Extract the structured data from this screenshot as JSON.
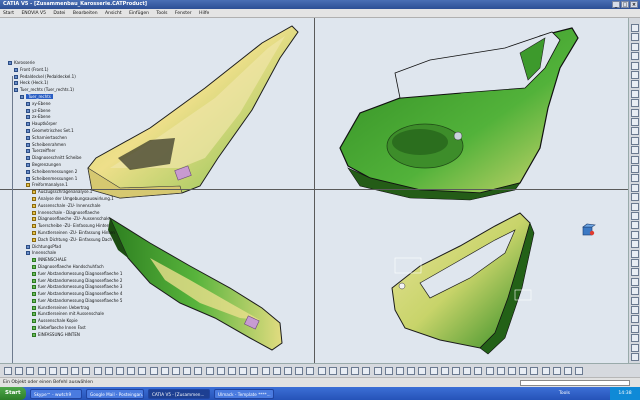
{
  "window": {
    "title": "CATIA V5 - [Zusammenbau_Karosserie.CATProduct]",
    "controls": [
      "_",
      "□",
      "×"
    ]
  },
  "menu": [
    "Start",
    "ENOVIA V5",
    "Datei",
    "Bearbeiten",
    "Ansicht",
    "Einfügen",
    "Tools",
    "Fenster",
    "Hilfe"
  ],
  "tree": [
    {
      "label": "Karosserie",
      "indent": 0,
      "icon": "product-icon"
    },
    {
      "label": "Front (Front.1)",
      "indent": 1,
      "icon": "part-icon"
    },
    {
      "label": "Pedaldeckel (Pedaldeckel.1)",
      "indent": 1,
      "icon": "part-icon"
    },
    {
      "label": "Heck (Heck.1)",
      "indent": 1,
      "icon": "part-icon"
    },
    {
      "label": "Tuer_rechts (Tuer_rechts.1)",
      "indent": 1,
      "icon": "part-icon"
    },
    {
      "label": "Tuer_rechts",
      "indent": 2,
      "icon": "part-icon",
      "selected": true
    },
    {
      "label": "xy-Ebene",
      "indent": 3,
      "icon": "plane-icon"
    },
    {
      "label": "yz-Ebene",
      "indent": 3,
      "icon": "plane-icon"
    },
    {
      "label": "zx-Ebene",
      "indent": 3,
      "icon": "plane-icon"
    },
    {
      "label": "Hauptkörper",
      "indent": 3,
      "icon": "body-icon"
    },
    {
      "label": "Geometrisches Set.1",
      "indent": 3,
      "icon": "set-icon"
    },
    {
      "label": "Scharniertaschen",
      "indent": 3,
      "icon": "set-icon"
    },
    {
      "label": "Scheibenrahmen",
      "indent": 3,
      "icon": "set-icon"
    },
    {
      "label": "Tuerzeiffner",
      "indent": 3,
      "icon": "set-icon"
    },
    {
      "label": "Diagnoseschnitt Scheibe",
      "indent": 3,
      "icon": "set-icon"
    },
    {
      "label": "Begrenzungen",
      "indent": 3,
      "icon": "set-icon"
    },
    {
      "label": "Scheibenmessungen 2",
      "indent": 3,
      "icon": "set-icon"
    },
    {
      "label": "Scheibenmessungen 1",
      "indent": 3,
      "icon": "set-icon"
    },
    {
      "label": "Freiformanalyse.1",
      "indent": 3,
      "icon": "analysis-icon"
    },
    {
      "label": "Auszugsschrägenanalyse.1",
      "indent": 4,
      "icon": "analysis-icon"
    },
    {
      "label": "Analyse der Umgebungsauswirkung.1",
      "indent": 4,
      "icon": "analysis-icon"
    },
    {
      "label": "Aussenschale -ZU- Innenschale",
      "indent": 4,
      "icon": "analysis-icon"
    },
    {
      "label": "Innenschale - Diagnoseflaeche",
      "indent": 4,
      "icon": "analysis-icon"
    },
    {
      "label": "Diagnoseflaeche -ZU- Aussenschale",
      "indent": 4,
      "icon": "analysis-icon"
    },
    {
      "label": "Tuerscheibe -ZU- Einfassung Hinten",
      "indent": 4,
      "icon": "analysis-icon"
    },
    {
      "label": "Kunstlerseinen -ZU- Einfassung Hinten",
      "indent": 4,
      "icon": "analysis-icon"
    },
    {
      "label": "Dach Dichtung -ZU- Einfassung Dach",
      "indent": 4,
      "icon": "analysis-icon"
    },
    {
      "label": "DichtungsPfad",
      "indent": 3,
      "icon": "set-icon"
    },
    {
      "label": "Innenschale",
      "indent": 3,
      "icon": "set-icon"
    },
    {
      "label": "INNENSCHALE",
      "indent": 4,
      "icon": "surface-icon"
    },
    {
      "label": "Diagnoseflaeche Handschuhfach",
      "indent": 4,
      "icon": "surface-icon"
    },
    {
      "label": "fuer Abstandsmessung Diagnoseflaeche 1",
      "indent": 4,
      "icon": "surface-icon"
    },
    {
      "label": "fuer Abstandsmessung Diagnoseflaeche 2",
      "indent": 4,
      "icon": "surface-icon"
    },
    {
      "label": "fuer Abstandsmessung Diagnoseflaeche 3",
      "indent": 4,
      "icon": "surface-icon"
    },
    {
      "label": "fuer Abstandsmessung Diagnoseflaeche 4",
      "indent": 4,
      "icon": "surface-icon"
    },
    {
      "label": "fuer Abstandsmessung Diagnoseflaeche 5",
      "indent": 4,
      "icon": "surface-icon"
    },
    {
      "label": "Kunstlerseinen Uebertrag",
      "indent": 4,
      "icon": "surface-icon"
    },
    {
      "label": "Kunstlerseinen mit Aussenschale",
      "indent": 4,
      "icon": "surface-icon"
    },
    {
      "label": "Aussenschale Kopie",
      "indent": 4,
      "icon": "surface-icon"
    },
    {
      "label": "Klebeflaeche Innen Fast",
      "indent": 4,
      "icon": "surface-icon"
    },
    {
      "label": "EINFASSUNG HINTEN",
      "indent": 4,
      "icon": "surface-icon"
    }
  ],
  "status": {
    "message": "Ein Objekt oder einen Befehl auswählen",
    "input_value": ""
  },
  "taskbar": {
    "start": "Start",
    "tasks": [
      {
        "label": "Skype™ - wwtch9",
        "active": false
      },
      {
        "label": "Google Mail - Posteingan...",
        "active": false
      },
      {
        "label": "CATIA V5 - [Zusammen...",
        "active": true
      },
      {
        "label": "Ulmack - Template ****...",
        "active": false
      }
    ],
    "clock": "14:38",
    "tray": "Tools"
  },
  "colors": {
    "viewport_bg": "#dfe6ee",
    "surface_green": "#3a9a2a",
    "surface_yellow": "#e8d56a",
    "tree_selection": "#2b5fc4"
  }
}
